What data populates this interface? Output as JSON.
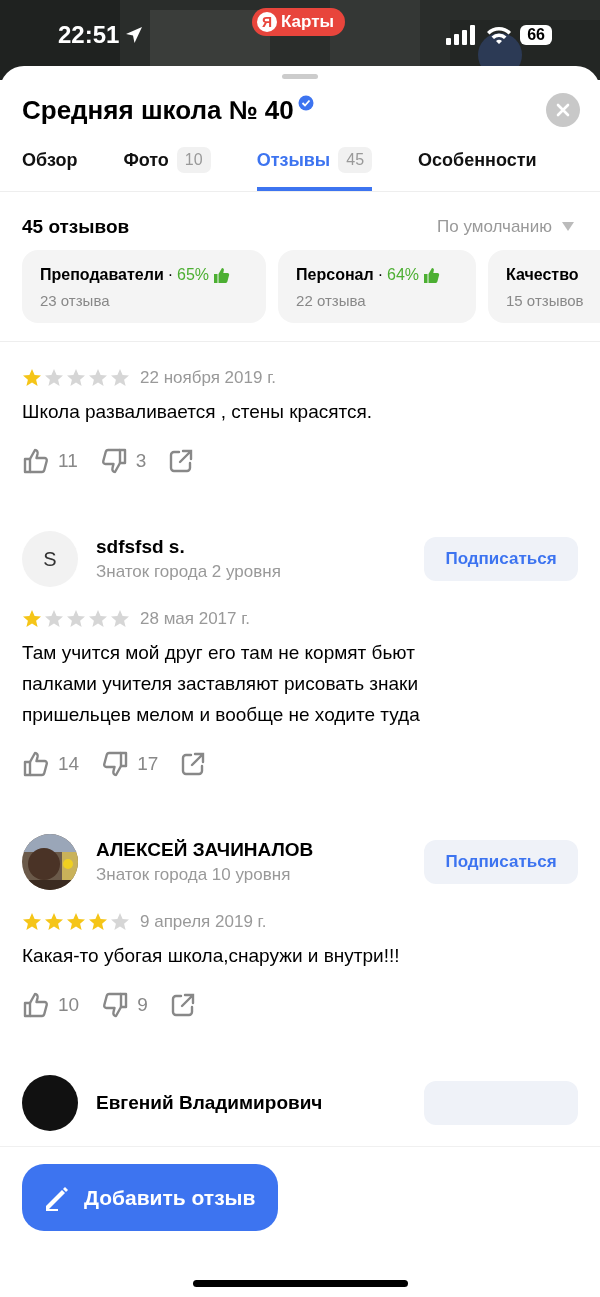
{
  "status_bar": {
    "time": "22:51",
    "app_badge": {
      "logo": "Я",
      "label": "Карты"
    },
    "battery": "66"
  },
  "place": {
    "title": "Средняя школа № 40",
    "verified": true
  },
  "tabs": [
    {
      "label": "Обзор",
      "selected": false
    },
    {
      "label": "Фото",
      "count": "10",
      "selected": false
    },
    {
      "label": "Отзывы",
      "count": "45",
      "selected": true
    },
    {
      "label": "Особенности",
      "selected": false
    }
  ],
  "summary": {
    "count": "45 отзывов",
    "sort": "По умолчанию"
  },
  "categories": [
    {
      "name": "Преподаватели",
      "separator": "·",
      "percent": "65%",
      "count": "23 отзыва"
    },
    {
      "name": "Персонал",
      "separator": "·",
      "percent": "64%",
      "count": "22 отзыва"
    },
    {
      "name": "Качество",
      "count": "15 отзывов"
    }
  ],
  "reviews": [
    {
      "stars": 1,
      "date": "22 ноября 2019 г.",
      "text": "Школа разваливается , стены красятся.",
      "likes": "11",
      "dislikes": "3"
    },
    {
      "avatar": {
        "kind": "letter",
        "letter": "S"
      },
      "author": "sdfsfsd s.",
      "level": "Знаток города 2 уровня",
      "subscribe": "Подписаться",
      "stars": 1,
      "date": "28 мая 2017 г.",
      "text": "Там учится мой друг его там не кормят бьют палками учителя заставляют рисовать знаки пришельцев мелом и вообще не ходите туда",
      "likes": "14",
      "dislikes": "17"
    },
    {
      "author": "АЛЕКСЕЙ ЗАЧИНАЛОВ",
      "level": "Знаток города 10 уровня",
      "subscribe": "Подписаться",
      "stars": 4,
      "date": "9 апреля 2019 г.",
      "text": "Какая-то убогая школа,снаружи и внутри!!!",
      "likes": "10",
      "dislikes": "9"
    },
    {
      "avatar": {
        "kind": "dark"
      },
      "author": "Евгений Владимирович"
    }
  ],
  "add_review": {
    "label": "Добавить отзыв"
  }
}
